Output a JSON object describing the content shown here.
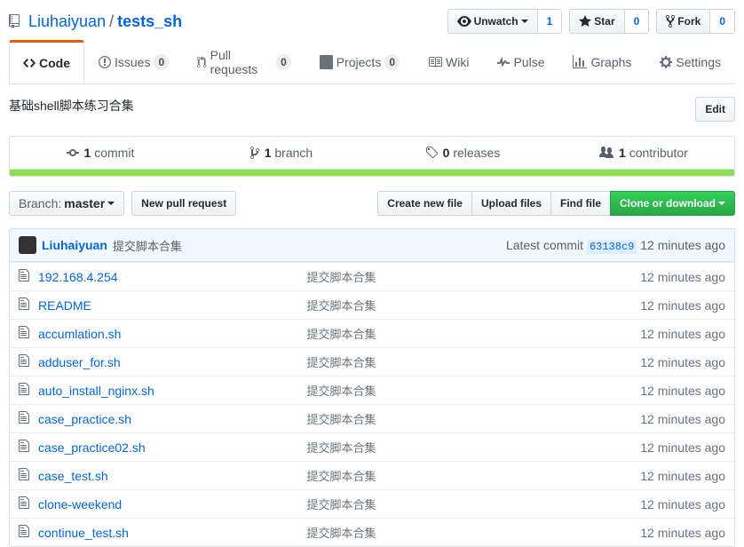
{
  "breadcrumb": {
    "owner": "Liuhaiyuan",
    "sep": "/",
    "repo": "tests_sh"
  },
  "watch": {
    "label": "Unwatch",
    "count": "1"
  },
  "star": {
    "label": "Star",
    "count": "0"
  },
  "fork": {
    "label": "Fork",
    "count": "0"
  },
  "nav": {
    "code": "Code",
    "issues": {
      "label": "Issues",
      "count": "0"
    },
    "pulls": {
      "label": "Pull requests",
      "count": "0"
    },
    "projects": {
      "label": "Projects",
      "count": "0"
    },
    "wiki": "Wiki",
    "pulse": "Pulse",
    "graphs": "Graphs",
    "settings": "Settings"
  },
  "description": {
    "text": "基础shell脚本练习合集",
    "edit": "Edit"
  },
  "stats": {
    "commits": {
      "num": "1",
      "label": "commit"
    },
    "branches": {
      "num": "1",
      "label": "branch"
    },
    "releases": {
      "num": "0",
      "label": "releases"
    },
    "contributors": {
      "num": "1",
      "label": "contributor"
    }
  },
  "branch": {
    "prefix": "Branch:",
    "name": "master"
  },
  "newpull": "New pull request",
  "filebtns": {
    "create": "Create new file",
    "upload": "Upload files",
    "find": "Find file",
    "clone": "Clone or download"
  },
  "commit": {
    "author": "Liuhaiyuan",
    "msg": "提交脚本合集",
    "latest": "Latest commit",
    "sha": "63138c9",
    "age": "12 minutes ago"
  },
  "file_msg": "提交脚本合集",
  "file_age": "12 minutes ago",
  "files": {
    "f0": "192.168.4.254",
    "f1": "README",
    "f2": "accumlation.sh",
    "f3": "adduser_for.sh",
    "f4": "auto_install_nginx.sh",
    "f5": "case_practice.sh",
    "f6": "case_practice02.sh",
    "f7": "case_test.sh",
    "f8": "clone-weekend",
    "f9": "continue_test.sh"
  }
}
